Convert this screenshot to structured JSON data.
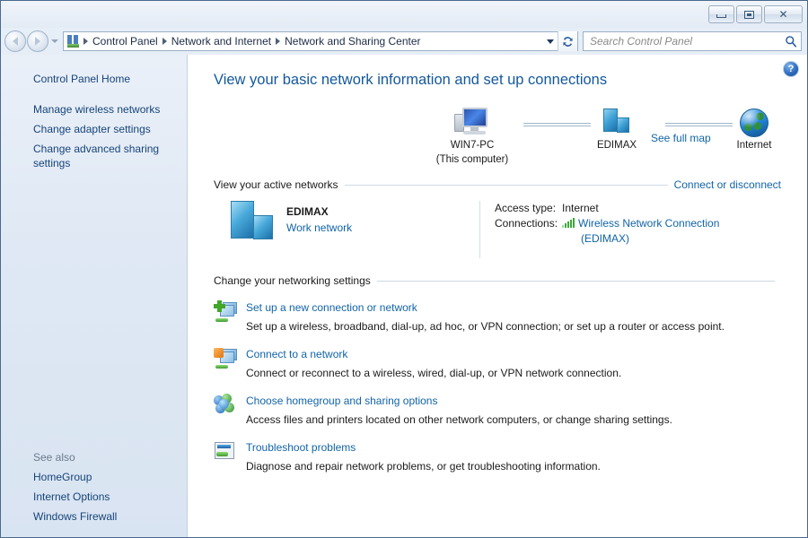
{
  "window": {
    "controls": {
      "minimize_label": "Minimize",
      "maximize_label": "Maximize",
      "close_label": "✕"
    }
  },
  "navbar": {
    "back_label": "Back",
    "forward_label": "Forward",
    "recent_pages_label": "Recent pages",
    "breadcrumbs": [
      "Control Panel",
      "Network and Internet",
      "Network and Sharing Center"
    ],
    "address_dropdown_label": "Previous locations",
    "refresh_label": "Refresh",
    "icon": "control-panel-icon"
  },
  "search": {
    "placeholder": "Search Control Panel",
    "value": "",
    "icon": "search-icon"
  },
  "sidebar": {
    "home_label": "Control Panel Home",
    "items": [
      {
        "label": "Manage wireless networks"
      },
      {
        "label": "Change adapter settings"
      },
      {
        "label": "Change advanced sharing settings"
      }
    ],
    "see_also_label": "See also",
    "see_also_items": [
      {
        "label": "HomeGroup"
      },
      {
        "label": "Internet Options"
      },
      {
        "label": "Windows Firewall"
      }
    ]
  },
  "content": {
    "help_label": "?",
    "page_title": "View your basic network information and set up connections",
    "network_map": {
      "see_full_map_label": "See full map",
      "nodes": [
        {
          "icon": "computer-icon",
          "label": "WIN7-PC",
          "sublabel": "(This computer)"
        },
        {
          "icon": "server-icon",
          "label": "EDIMAX",
          "sublabel": ""
        },
        {
          "icon": "globe-icon",
          "label": "Internet",
          "sublabel": ""
        }
      ]
    },
    "active_networks": {
      "heading": "View your active networks",
      "action_label": "Connect or disconnect",
      "network_name": "EDIMAX",
      "network_type": "Work network",
      "network_icon": "server-icon",
      "details": [
        {
          "key": "Access type:",
          "value": "Internet",
          "is_link": false
        },
        {
          "key": "Connections:",
          "value": "Wireless Network Connection (EDIMAX)",
          "is_link": true
        }
      ],
      "access_type_key": "Access type:",
      "access_type_value": "Internet",
      "connections_key": "Connections:",
      "connections_value_line1": "Wireless Network Connection",
      "connections_value_line2": "(EDIMAX)",
      "signal_icon": "wireless-signal-icon"
    },
    "networking_settings": {
      "heading": "Change your networking settings",
      "tasks": [
        {
          "icon": "new-connection-icon",
          "title": "Set up a new connection or network",
          "description": "Set up a wireless, broadband, dial-up, ad hoc, or VPN connection; or set up a router or access point."
        },
        {
          "icon": "connect-network-icon",
          "title": "Connect to a network",
          "description": "Connect or reconnect to a wireless, wired, dial-up, or VPN network connection."
        },
        {
          "icon": "homegroup-icon",
          "title": "Choose homegroup and sharing options",
          "description": "Access files and printers located on other network computers, or change sharing settings."
        },
        {
          "icon": "troubleshoot-icon",
          "title": "Troubleshoot problems",
          "description": "Diagnose and repair network problems, or get troubleshooting information."
        }
      ]
    }
  },
  "colors": {
    "link": "#1264a8",
    "title": "#14589c",
    "sidebar_link": "#16447a",
    "window_border": "#4a6a90"
  }
}
